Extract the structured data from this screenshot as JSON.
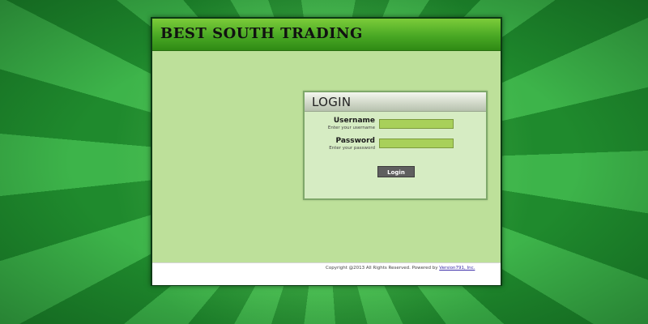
{
  "app": {
    "brand": "Best South Trading"
  },
  "login": {
    "title": "LOGIN",
    "username": {
      "label": "Username",
      "hint": "Enter your username",
      "value": ""
    },
    "password": {
      "label": "Password",
      "hint": "Enter your password",
      "value": ""
    },
    "button_label": "Login"
  },
  "footer": {
    "text": "Copyright @2013 All Rights Reserved. Powered by",
    "link_text": "Version791, Inc."
  },
  "colors": {
    "header_green": "#49a824",
    "content_bg": "#bde09a",
    "input_bg": "#a8d05a",
    "button_bg": "#5f5f5f",
    "link": "#3a2aa8"
  },
  "icons": {
    "background": "green-sunburst"
  }
}
